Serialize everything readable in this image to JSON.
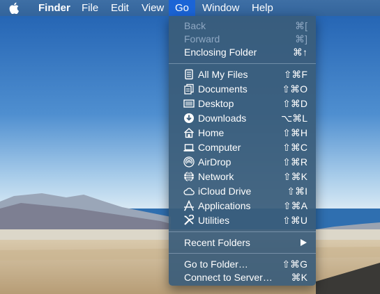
{
  "menubar": {
    "app_name": "Finder",
    "items": [
      "File",
      "Edit",
      "View",
      "Go",
      "Window",
      "Help"
    ],
    "active": "Go"
  },
  "go_menu": {
    "nav": [
      {
        "label": "Back",
        "shortcut": "⌘[",
        "enabled": false
      },
      {
        "label": "Forward",
        "shortcut": "⌘]",
        "enabled": false
      },
      {
        "label": "Enclosing Folder",
        "shortcut": "⌘↑",
        "enabled": true
      }
    ],
    "places": [
      {
        "label": "All My Files",
        "shortcut": "⇧⌘F",
        "icon": "all-my-files-icon"
      },
      {
        "label": "Documents",
        "shortcut": "⇧⌘O",
        "icon": "documents-icon"
      },
      {
        "label": "Desktop",
        "shortcut": "⇧⌘D",
        "icon": "desktop-icon"
      },
      {
        "label": "Downloads",
        "shortcut": "⌥⌘L",
        "icon": "downloads-icon"
      },
      {
        "label": "Home",
        "shortcut": "⇧⌘H",
        "icon": "home-icon"
      },
      {
        "label": "Computer",
        "shortcut": "⇧⌘C",
        "icon": "computer-icon"
      },
      {
        "label": "AirDrop",
        "shortcut": "⇧⌘R",
        "icon": "airdrop-icon"
      },
      {
        "label": "Network",
        "shortcut": "⇧⌘K",
        "icon": "network-icon"
      },
      {
        "label": "iCloud Drive",
        "shortcut": "⇧⌘I",
        "icon": "icloud-icon"
      },
      {
        "label": "Applications",
        "shortcut": "⇧⌘A",
        "icon": "applications-icon"
      },
      {
        "label": "Utilities",
        "shortcut": "⇧⌘U",
        "icon": "utilities-icon"
      }
    ],
    "recent_folders": {
      "label": "Recent Folders"
    },
    "bottom": [
      {
        "label": "Go to Folder…",
        "shortcut": "⇧⌘G"
      },
      {
        "label": "Connect to Server…",
        "shortcut": "⌘K"
      }
    ]
  }
}
